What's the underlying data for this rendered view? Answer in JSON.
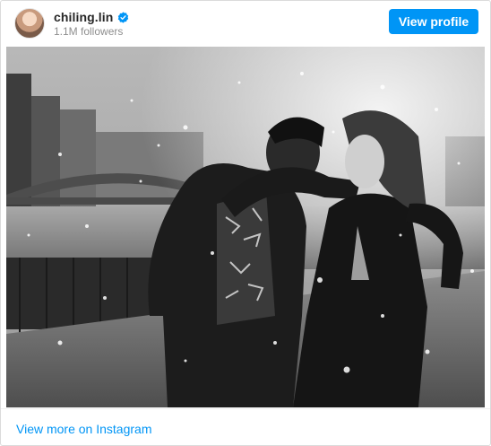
{
  "account": {
    "username": "chiling.lin",
    "followers": "1.1M followers",
    "verified": true
  },
  "header": {
    "view_profile_label": "View profile"
  },
  "post": {
    "image_alt": "Black and white photo of a couple walking along a waterfront promenade",
    "tone": "black-and-white"
  },
  "footer": {
    "view_more_label": "View more on Instagram"
  },
  "colors": {
    "accent": "#0095f6",
    "username": "#262626",
    "muted": "#8e8e8e",
    "border": "#dbdbdb"
  },
  "icons": {
    "verified": "verified-badge-icon"
  }
}
